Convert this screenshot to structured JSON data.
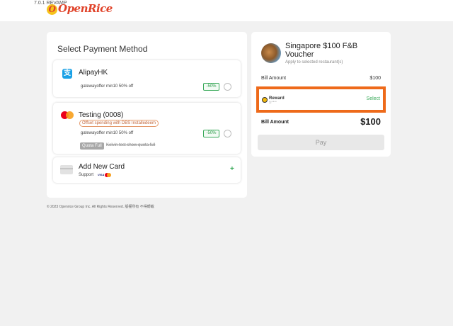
{
  "header": {
    "version": "7.0.1 REVAMP",
    "logo": "OpenRice"
  },
  "payment": {
    "title": "Select Payment Method",
    "methods": [
      {
        "name": "AlipayHK",
        "gateway_offer": "gatewayoffer min10 50% off",
        "discount": "-50%"
      },
      {
        "name": "Testing (0008)",
        "offset_tag": "Offset spending with DBS Installedeem",
        "gateway_offer": "gatewayoffer min10 50% off",
        "discount": "-50%",
        "quota_badge": "Quota Full",
        "quota_text": "Kelvin test show quota full"
      }
    ],
    "add_card": {
      "label": "Add New Card",
      "support": "Support",
      "visa": "VISA",
      "plus": "+"
    }
  },
  "footer": {
    "copyright": "© 2023 Openrice Group Inc. All Rights Reserved. 版權所有 不得轉載"
  },
  "voucher": {
    "title": "Singapore $100 F&B Voucher",
    "subtitle": "Apply to selected restaurant(s)",
    "bill_amount_label": "Bill Amount",
    "bill_amount_value": "$100",
    "reward_name": "Reward",
    "reward_sub": "DOUBLE UP",
    "select_label": "Select",
    "total_label": "Bill Amount",
    "total_value": "$100",
    "pay_label": "Pay"
  },
  "colors": {
    "accent_green": "#3aaa5a",
    "highlight_orange": "#ee6a1a",
    "brand_red": "#e0432a"
  }
}
